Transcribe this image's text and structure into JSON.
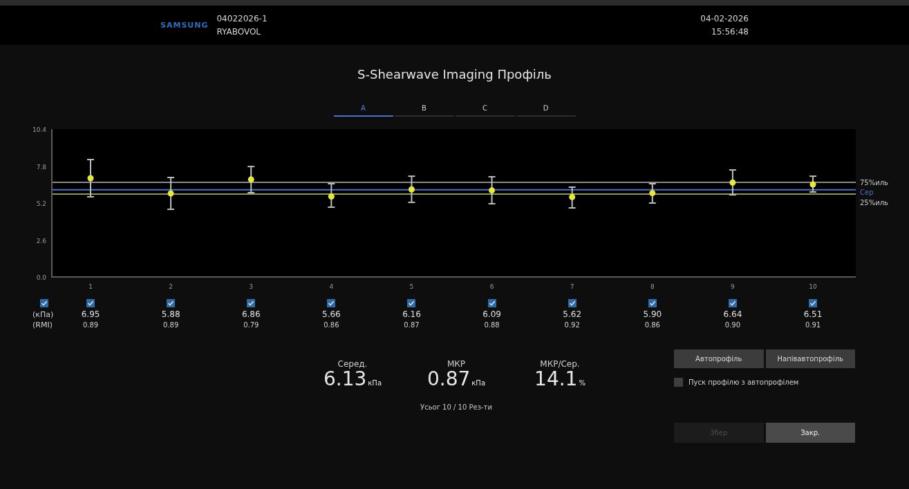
{
  "header": {
    "logo": "SAMSUNG",
    "patient_id": "04022026-1",
    "patient_name": "RYABOVOL",
    "date": "04-02-2026",
    "time": "15:56:48"
  },
  "title": "S-Shearwave Imaging Профіль",
  "tabs": [
    {
      "label": "A",
      "selected": true
    },
    {
      "label": "B",
      "selected": false
    },
    {
      "label": "C",
      "selected": false
    },
    {
      "label": "D",
      "selected": false
    }
  ],
  "chart_data": {
    "type": "scatter",
    "categories": [
      "1",
      "2",
      "3",
      "4",
      "5",
      "6",
      "7",
      "8",
      "9",
      "10"
    ],
    "ylim": [
      0,
      10.4
    ],
    "yticks": [
      {
        "value": 0,
        "label": "0.0"
      },
      {
        "value": 2.6,
        "label": "2.6"
      },
      {
        "value": 5.2,
        "label": "5.2"
      },
      {
        "value": 7.8,
        "label": "7.8"
      },
      {
        "value": 10.4,
        "label": "10.4"
      }
    ],
    "series": [
      {
        "color": "#e8e83a",
        "values": [
          6.95,
          5.88,
          6.86,
          5.66,
          6.16,
          6.09,
          5.62,
          5.9,
          6.64,
          6.51
        ],
        "errors": [
          [
            5.64,
            8.26
          ],
          [
            4.76,
            7.0
          ],
          [
            5.93,
            7.77
          ],
          [
            4.91,
            6.56
          ],
          [
            5.25,
            7.09
          ],
          [
            5.15,
            7.05
          ],
          [
            4.86,
            6.32
          ],
          [
            5.2,
            6.56
          ],
          [
            5.78,
            7.53
          ],
          [
            5.98,
            7.09
          ]
        ]
      }
    ],
    "ref_lines": [
      {
        "axis": "y",
        "value": 6.66,
        "label": "75%иль",
        "color": "#8a8a8a"
      },
      {
        "axis": "y",
        "value": 6.13,
        "label": "Сер",
        "color": "#4a6fd0"
      },
      {
        "axis": "y",
        "value": 5.83,
        "label": "25%иль",
        "color": "#8f9a4a"
      }
    ]
  },
  "select_all": {
    "checked": true
  },
  "row_labels": [
    "(кПа)",
    "(RMI)"
  ],
  "columns": [
    {
      "checked": true,
      "kpa": "6.95",
      "rmi": "0.89"
    },
    {
      "checked": true,
      "kpa": "5.88",
      "rmi": "0.89"
    },
    {
      "checked": true,
      "kpa": "6.86",
      "rmi": "0.79"
    },
    {
      "checked": true,
      "kpa": "5.66",
      "rmi": "0.86"
    },
    {
      "checked": true,
      "kpa": "6.16",
      "rmi": "0.87"
    },
    {
      "checked": true,
      "kpa": "6.09",
      "rmi": "0.88"
    },
    {
      "checked": true,
      "kpa": "5.62",
      "rmi": "0.92"
    },
    {
      "checked": true,
      "kpa": "5.90",
      "rmi": "0.86"
    },
    {
      "checked": true,
      "kpa": "6.64",
      "rmi": "0.90"
    },
    {
      "checked": true,
      "kpa": "6.51",
      "rmi": "0.91"
    }
  ],
  "stats": [
    {
      "label": "Серед.",
      "value": "6.13",
      "unit": "кПа"
    },
    {
      "label": "МКР",
      "value": "0.87",
      "unit": "кПа"
    },
    {
      "label": "МКР/Сер.",
      "value": "14.1",
      "unit": "%"
    }
  ],
  "total": "Усьог 10 / 10 Рез-ти",
  "profile_buttons": [
    {
      "label": "Автопрофіль",
      "disabled": false
    },
    {
      "label": "Напівавтопрофіль",
      "disabled": false
    }
  ],
  "auto_start": {
    "label": "Пуск профілю з автопрофілем",
    "checked": false
  },
  "action_buttons": [
    {
      "label": "Збер",
      "disabled": true
    },
    {
      "label": "Закр.",
      "disabled": false
    }
  ]
}
